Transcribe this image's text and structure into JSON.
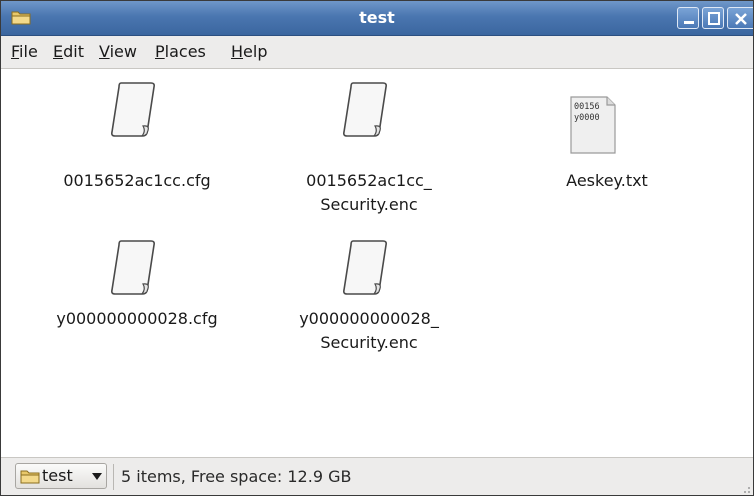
{
  "window": {
    "title": "test",
    "accent": "#4a76b0"
  },
  "menubar": {
    "items": [
      {
        "label": "File",
        "mnemonic": "F",
        "rest": "ile"
      },
      {
        "label": "Edit",
        "mnemonic": "E",
        "rest": "dit"
      },
      {
        "label": "View",
        "mnemonic": "V",
        "rest": "iew"
      },
      {
        "label": "Places",
        "mnemonic": "P",
        "rest": "laces"
      },
      {
        "label": "Help",
        "mnemonic": "H",
        "rest": "elp"
      }
    ]
  },
  "files": [
    {
      "name_line1": "0015652ac1cc.cfg",
      "name_line2": "",
      "icon": "document-icon"
    },
    {
      "name_line1": "0015652ac1cc_",
      "name_line2": "Security.enc",
      "icon": "document-icon"
    },
    {
      "name_line1": "Aeskey.txt",
      "name_line2": "",
      "icon": "text-file-icon",
      "preview_line1": "00156",
      "preview_line2": "y0000"
    },
    {
      "name_line1": "y000000000028.cfg",
      "name_line2": "",
      "icon": "document-icon"
    },
    {
      "name_line1": "y000000000028_",
      "name_line2": "Security.enc",
      "icon": "document-icon"
    }
  ],
  "statusbar": {
    "location": "test",
    "info": "5 items, Free space: 12.9 GB"
  }
}
